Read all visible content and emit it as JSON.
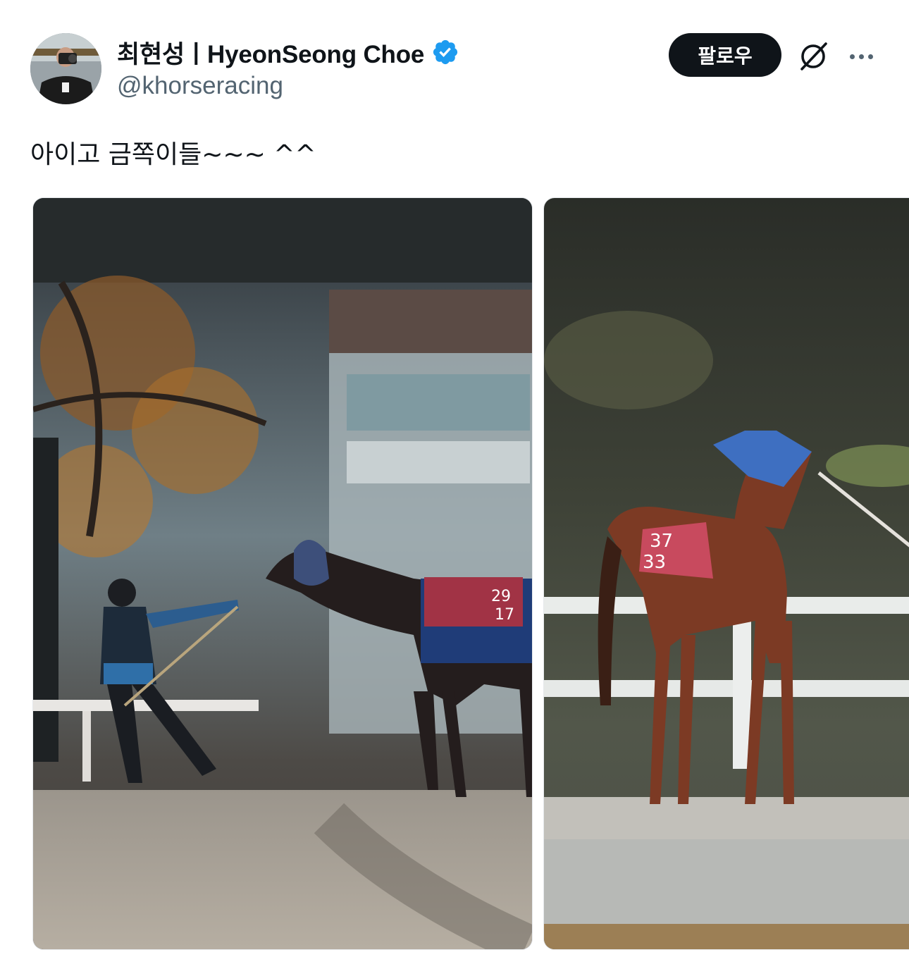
{
  "tweet": {
    "author": {
      "display_name": "최현성ㅣHyeonSeong Choe",
      "handle": "@khorseracing",
      "verified": true,
      "avatar_icon": "photographer-avatar"
    },
    "actions": {
      "follow_label": "팔로우",
      "grok_icon": "grok-icon",
      "more_icon": "more-dots-icon"
    },
    "text": "아이고 금쪽이들~~~ ^^",
    "media": [
      {
        "description_icon": "horse-photo",
        "saddle_numbers": [
          "29",
          "17"
        ]
      },
      {
        "description_icon": "horse-photo",
        "saddle_numbers": [
          "37",
          "33"
        ]
      }
    ],
    "colors": {
      "verified_blue": "#1d9bf0",
      "follow_button_bg": "#0f1419",
      "secondary_text": "#536471"
    }
  }
}
